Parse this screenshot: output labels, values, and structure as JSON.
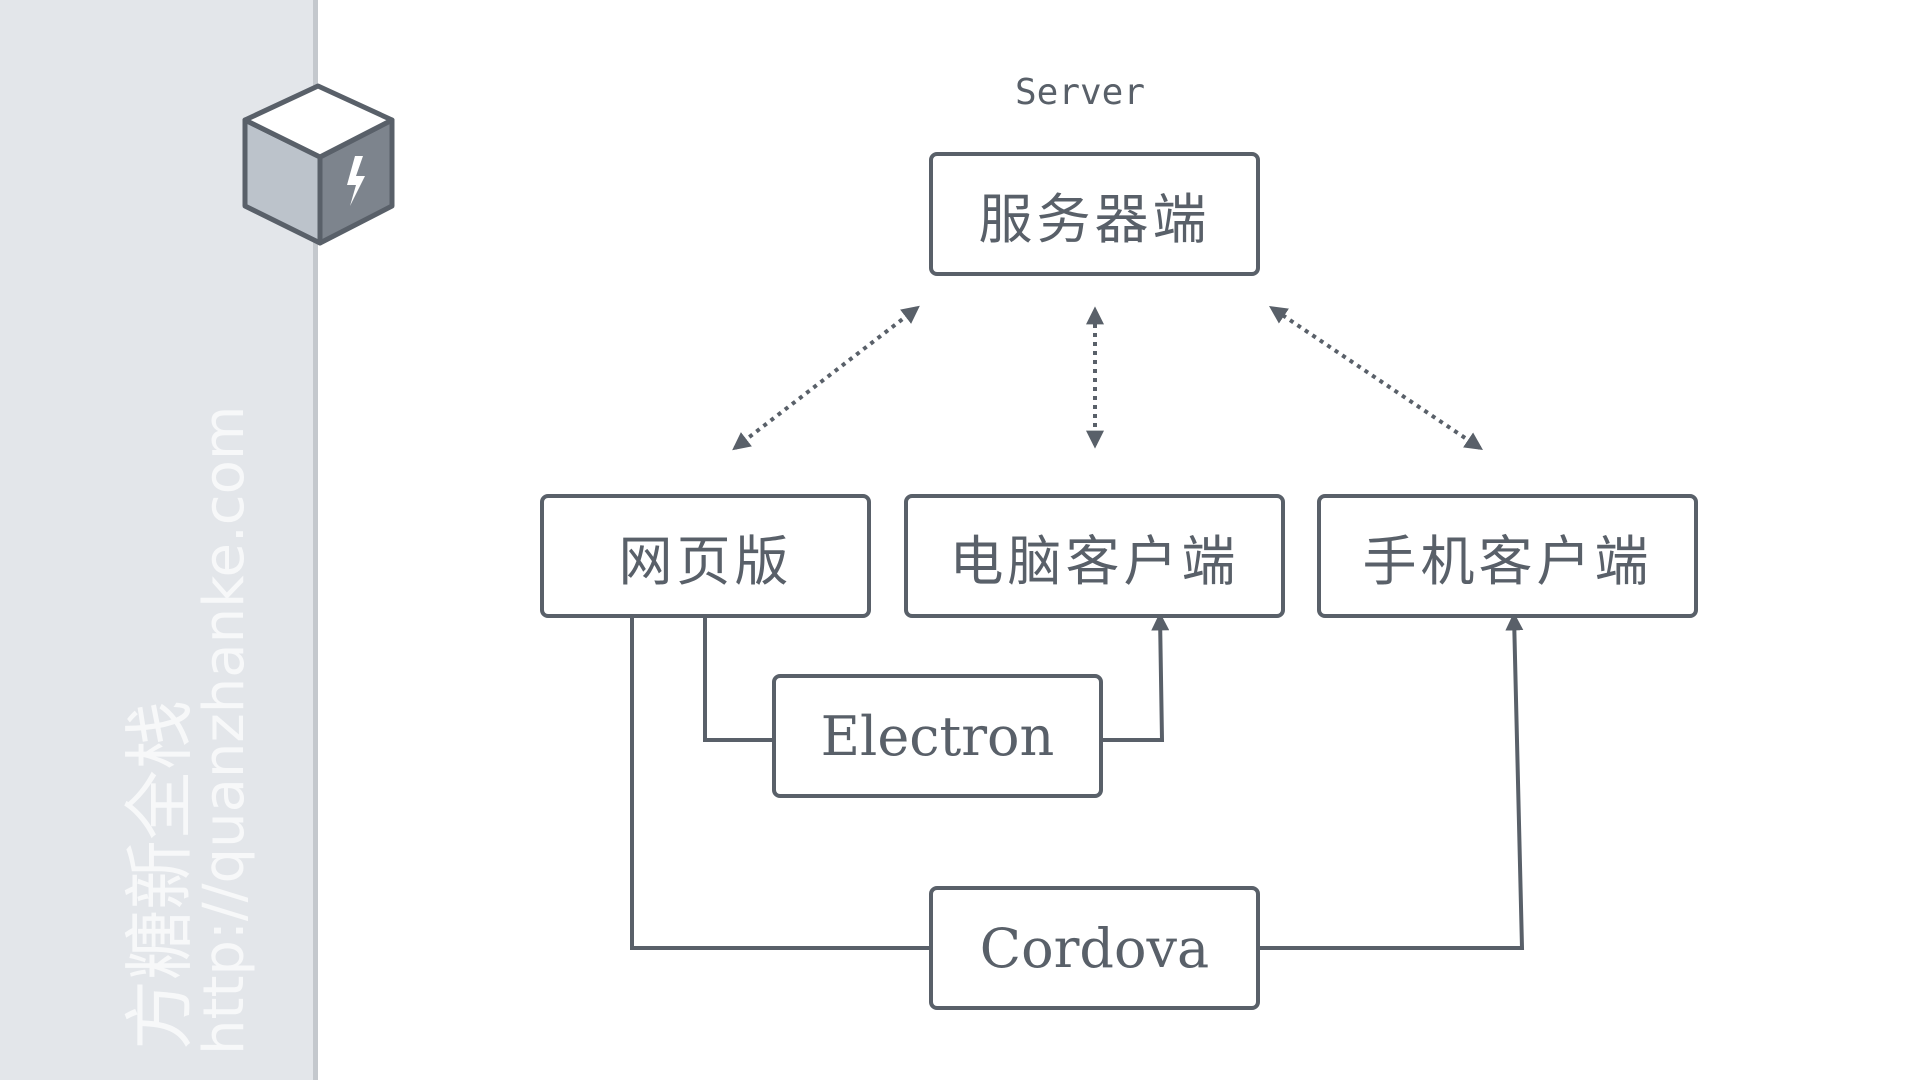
{
  "sidebar": {
    "brand": "方糖新全栈",
    "url": "http://quanzhanke.com",
    "logo_icon": "cube-lightning-icon"
  },
  "diagram": {
    "server_caption": "Server",
    "nodes": {
      "server": "服务器端",
      "web": "网页版",
      "desktop": "电脑客户端",
      "mobile": "手机客户端",
      "electron": "Electron",
      "cordova": "Cordova"
    },
    "colors": {
      "stroke": "#596069",
      "sidebar_bg": "#e3e6ea",
      "sidebar_border": "#c4c8cd",
      "watermark_text": "#f7f8f9"
    }
  }
}
